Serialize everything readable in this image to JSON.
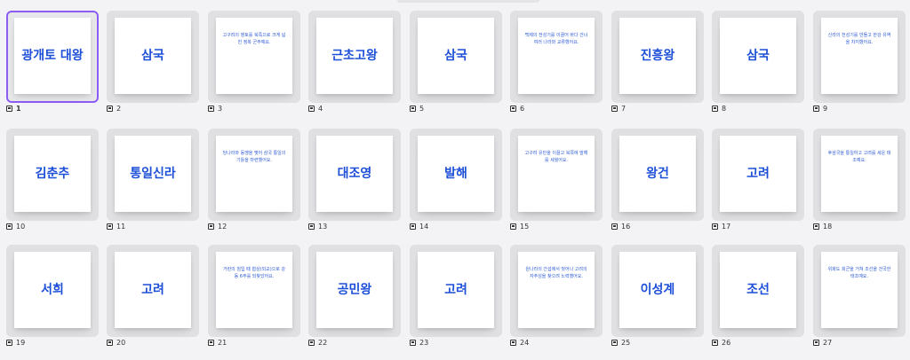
{
  "slides": [
    {
      "n": "1",
      "kind": "big",
      "text": "광개토 대왕",
      "selected": true
    },
    {
      "n": "2",
      "kind": "big",
      "text": "삼국"
    },
    {
      "n": "3",
      "kind": "small",
      "text": "고구려의 영토를 북쪽으로 크게 넓힌 정복 군주예요."
    },
    {
      "n": "4",
      "kind": "big",
      "text": "근초고왕"
    },
    {
      "n": "5",
      "kind": "big",
      "text": "삼국"
    },
    {
      "n": "6",
      "kind": "small",
      "text": "백제의 전성기를 이끌어 바다 건너 여러 나라와 교류했어요."
    },
    {
      "n": "7",
      "kind": "big",
      "text": "진흥왕"
    },
    {
      "n": "8",
      "kind": "big",
      "text": "삼국"
    },
    {
      "n": "9",
      "kind": "small",
      "text": "신라의 전성기를 만들고 한강 유역을 차지했어요."
    },
    {
      "n": "10",
      "kind": "big",
      "text": "김춘추"
    },
    {
      "n": "11",
      "kind": "big",
      "text": "통일신라"
    },
    {
      "n": "12",
      "kind": "small",
      "text": "당나라와 동맹을 맺어 삼국 통일의 기틀을 마련했어요."
    },
    {
      "n": "13",
      "kind": "big",
      "text": "대조영"
    },
    {
      "n": "14",
      "kind": "big",
      "text": "발해"
    },
    {
      "n": "15",
      "kind": "small",
      "text": "고구려 유민을 이끌고 북쪽에 발해를 세웠어요."
    },
    {
      "n": "16",
      "kind": "big",
      "text": "왕건"
    },
    {
      "n": "17",
      "kind": "big",
      "text": "고려"
    },
    {
      "n": "18",
      "kind": "small",
      "text": "후삼국을 통일하고 고려를 세운 태조예요."
    },
    {
      "n": "19",
      "kind": "big",
      "text": "서희"
    },
    {
      "n": "20",
      "kind": "big",
      "text": "고려"
    },
    {
      "n": "21",
      "kind": "small",
      "text": "거란의 침입 때 협상(외교)으로 강동 6주를 되찾았어요."
    },
    {
      "n": "22",
      "kind": "big",
      "text": "공민왕"
    },
    {
      "n": "23",
      "kind": "big",
      "text": "고려"
    },
    {
      "n": "24",
      "kind": "small",
      "text": "원나라의 간섭에서 벗어나 고려의 자주성을 찾으려 노력했어요."
    },
    {
      "n": "25",
      "kind": "big",
      "text": "이성계"
    },
    {
      "n": "26",
      "kind": "big",
      "text": "조선"
    },
    {
      "n": "27",
      "kind": "small",
      "text": "위화도 회군을 거쳐 조선을 건국한 태조예요."
    }
  ],
  "icons": {
    "slide": "slide-icon"
  },
  "colors": {
    "accent": "#8b5cf6",
    "title_text": "#1d4fd8"
  }
}
